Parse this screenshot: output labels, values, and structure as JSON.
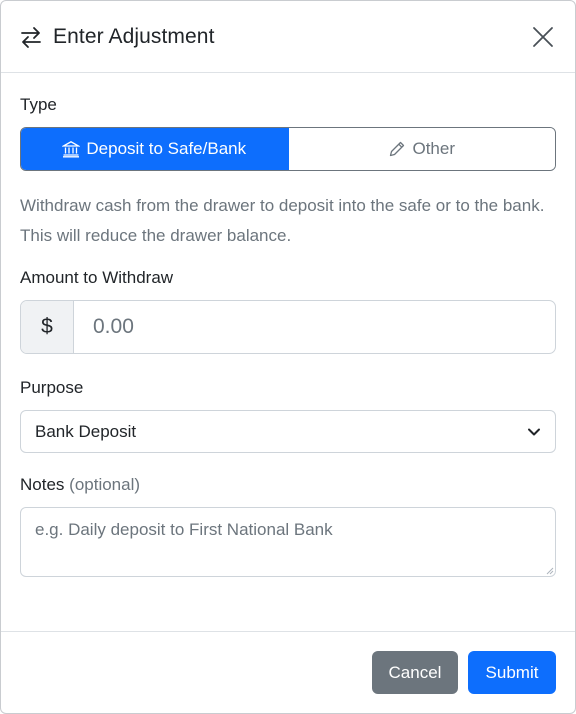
{
  "header": {
    "title": "Enter Adjustment",
    "title_icon": "arrows-left-right-icon",
    "close_icon": "close-icon"
  },
  "type": {
    "label": "Type",
    "options": [
      {
        "label": "Deposit to Safe/Bank",
        "icon": "bank-icon",
        "active": true
      },
      {
        "label": "Other",
        "icon": "pencil-icon",
        "active": false
      }
    ],
    "help": "Withdraw cash from the drawer to deposit into the safe or to the bank. This will reduce the drawer balance."
  },
  "amount": {
    "label": "Amount to Withdraw",
    "prefix": "$",
    "placeholder": "0.00"
  },
  "purpose": {
    "label": "Purpose",
    "selected": "Bank Deposit"
  },
  "notes": {
    "label": "Notes",
    "optional": "(optional)",
    "placeholder": "e.g. Daily deposit to First National Bank"
  },
  "footer": {
    "cancel": "Cancel",
    "submit": "Submit"
  },
  "colors": {
    "primary": "#0d6efd",
    "secondary": "#6c757d",
    "border": "#ced4da"
  }
}
